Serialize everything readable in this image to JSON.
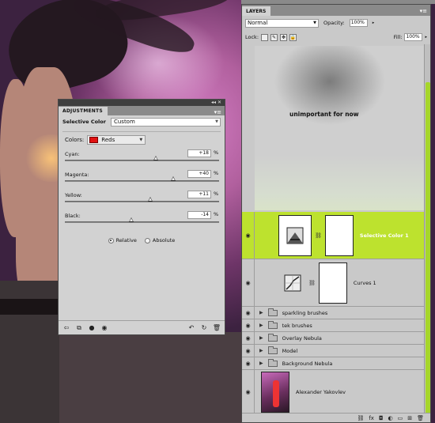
{
  "adjustments": {
    "tab_title": "ADJUSTMENTS",
    "menu_glyph": "▾≡",
    "collapse_glyph": "◂◂ ✕",
    "adjustment_type": "Selective Color",
    "preset_value": "Custom",
    "colors_label": "Colors:",
    "colors_value": "Reds",
    "colors_swatch_color": "#e11111",
    "sliders": [
      {
        "label": "Cyan:",
        "value": "+18",
        "unit": "%",
        "position_pct": 59
      },
      {
        "label": "Magenta:",
        "value": "+40",
        "unit": "%",
        "position_pct": 70
      },
      {
        "label": "Yellow:",
        "value": "+11",
        "unit": "%",
        "position_pct": 55.5
      },
      {
        "label": "Black:",
        "value": "-14",
        "unit": "%",
        "position_pct": 43
      }
    ],
    "radio_relative": "Relative",
    "radio_absolute": "Absolute",
    "selected_mode": "Relative"
  },
  "layers": {
    "tab_title": "LAYERS",
    "blend_mode": "Normal",
    "opacity_label": "Opacity:",
    "opacity_value": "100%",
    "lock_label": "Lock:",
    "fill_label": "Fill:",
    "fill_value": "100%",
    "overlay_text": "unimportant for now",
    "selected_layer": "Selective Color 1",
    "selection_color": "#bde22e",
    "items": [
      {
        "kind": "adjustment",
        "name": "Selective Color 1",
        "icon": "selective-color-icon",
        "selected": true
      },
      {
        "kind": "adjustment",
        "name": "Curves 1",
        "icon": "curves-icon",
        "selected": false
      },
      {
        "kind": "group",
        "name": "sparkling brushes"
      },
      {
        "kind": "group",
        "name": "tek brushes"
      },
      {
        "kind": "group",
        "name": "Overlay Nebula"
      },
      {
        "kind": "group",
        "name": "Model"
      },
      {
        "kind": "group",
        "name": "Background Nebula"
      },
      {
        "kind": "pixel",
        "name": "Alexander Yakovlev"
      }
    ],
    "footer_icons": [
      "link-icon",
      "fx-icon",
      "mask-icon",
      "adjustment-icon",
      "group-icon",
      "new-layer-icon",
      "trash-icon"
    ]
  }
}
